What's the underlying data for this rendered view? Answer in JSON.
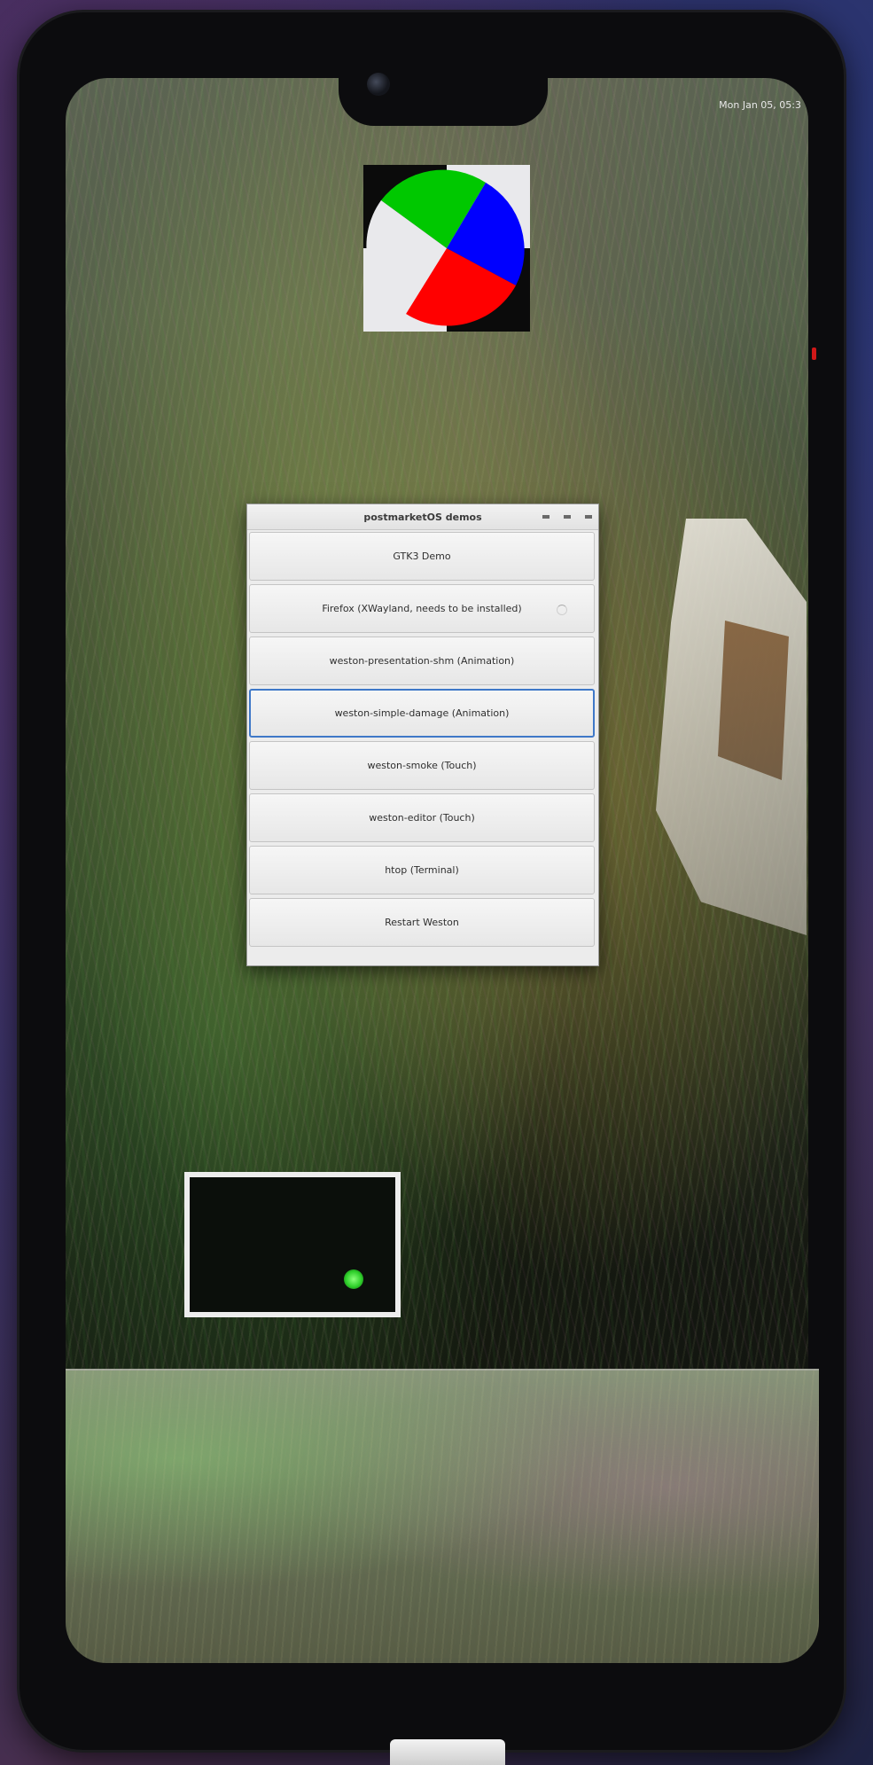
{
  "status_bar": {
    "clock": "Mon Jan 05, 05:3"
  },
  "launcher": {
    "title": "postmarketOS demos",
    "buttons": [
      {
        "label": "GTK3 Demo"
      },
      {
        "label": "Firefox (XWayland, needs to be installed)"
      },
      {
        "label": "weston-presentation-shm (Animation)"
      },
      {
        "label": "weston-simple-damage (Animation)"
      },
      {
        "label": "weston-smoke (Touch)"
      },
      {
        "label": "weston-editor (Touch)"
      },
      {
        "label": "htop (Terminal)"
      },
      {
        "label": "Restart Weston"
      }
    ]
  },
  "colors": {
    "focus_border": "#3f78c8",
    "pie_green": "#00c800",
    "pie_blue": "#0000ff",
    "pie_red": "#ff0000",
    "touch_dot": "#2fd02b"
  }
}
